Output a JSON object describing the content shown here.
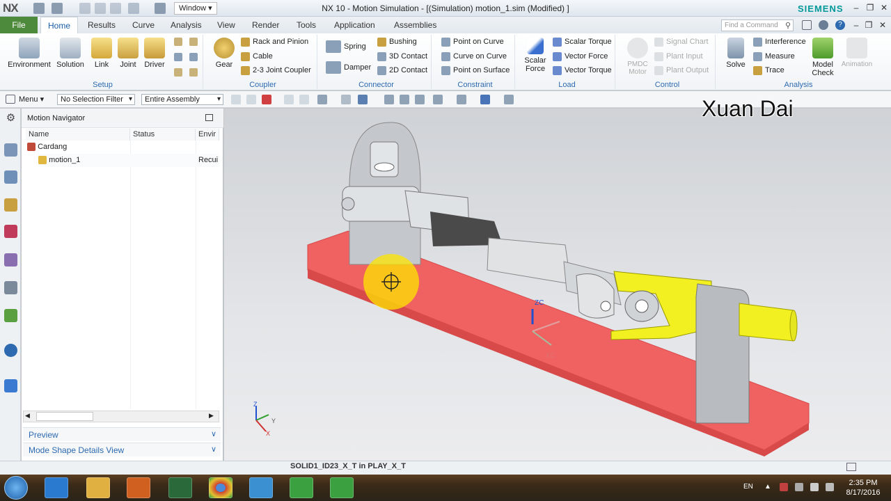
{
  "titlebar": {
    "logo": "NX",
    "window_menu": "Window ▾",
    "title": "NX 10 - Motion Simulation - [(Simulation) motion_1.sim (Modified) ]",
    "brand": "SIEMENS"
  },
  "tabs": {
    "file": "File",
    "items": [
      "Home",
      "Results",
      "Curve",
      "Analysis",
      "View",
      "Render",
      "Tools",
      "Application",
      "Assemblies"
    ],
    "find_placeholder": "Find a Command"
  },
  "ribbon": {
    "setup": {
      "label": "Setup",
      "buttons": [
        "Environment",
        "Solution",
        "Link",
        "Joint",
        "Driver"
      ]
    },
    "coupler": {
      "label": "Coupler",
      "gear": "Gear",
      "items": [
        "Rack and Pinion",
        "Cable",
        "2-3 Joint Coupler"
      ]
    },
    "connector": {
      "label": "Connector",
      "items": [
        "Spring",
        "Damper",
        "Bushing",
        "3D Contact",
        "2D Contact"
      ]
    },
    "constraint": {
      "label": "Constraint",
      "items": [
        "Point on Curve",
        "Curve on Curve",
        "Point on Surface"
      ]
    },
    "load": {
      "label": "Load",
      "scalar_force": "Scalar Force",
      "items": [
        "Scalar Torque",
        "Vector Force",
        "Vector Torque"
      ]
    },
    "control": {
      "label": "Control",
      "pmdc": "PMDC Motor",
      "items": [
        "Signal Chart",
        "Plant Input",
        "Plant Output"
      ]
    },
    "analysis": {
      "label": "Analysis",
      "solve": "Solve",
      "items": [
        "Interference",
        "Measure",
        "Trace"
      ],
      "model_check": "Model Check",
      "animation": "Animation"
    }
  },
  "toolbar": {
    "menu": "Menu ▾",
    "selection_filter": "No Selection Filter",
    "scope": "Entire Assembly"
  },
  "navigator": {
    "title": "Motion Navigator",
    "columns": [
      "Name",
      "Status",
      "Envir"
    ],
    "rows": [
      {
        "name": "Cardang",
        "status": "",
        "env": ""
      },
      {
        "name": "motion_1",
        "status": "",
        "env": "Recui"
      }
    ],
    "sections": [
      "Preview",
      "Mode Shape Details View"
    ]
  },
  "viewport": {
    "watermark": "Xuan Dai",
    "axis_labels": {
      "zc": "ZC",
      "xc": "XC",
      "z": "Z",
      "y": "Y",
      "x": "X"
    }
  },
  "statusbar": {
    "text": "SOLID1_ID23_X_T in PLAY_X_T"
  },
  "taskbar": {
    "lang": "EN",
    "time": "2:35 PM",
    "date": "8/17/2016"
  },
  "colors": {
    "accent": "#4e8a3c",
    "link": "#2d6ab0",
    "plate": "#f06060",
    "yoke": "#f0f020",
    "brand": "#009999"
  }
}
